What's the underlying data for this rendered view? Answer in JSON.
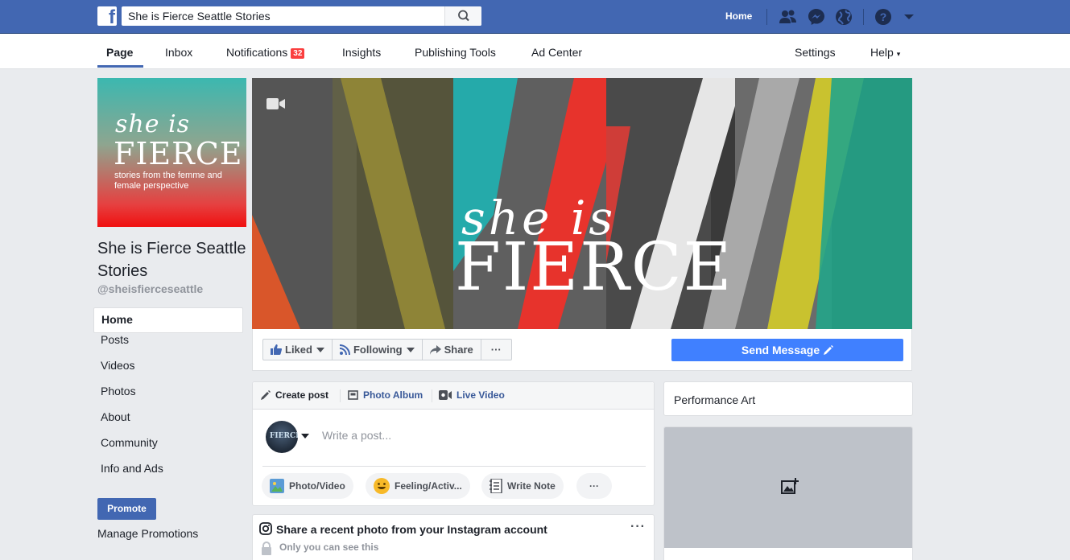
{
  "topbar": {
    "logo_letter": "f",
    "search_value": "She is Fierce Seattle Stories",
    "search_placeholder": "Search",
    "home_label": "Home",
    "icons": [
      "friends-icon",
      "messenger-icon",
      "globe-icon",
      "help-icon",
      "caret-down-icon"
    ]
  },
  "pagenav": {
    "tabs": [
      {
        "label": "Page"
      },
      {
        "label": "Inbox"
      },
      {
        "label": "Notifications",
        "badge": "32"
      },
      {
        "label": "Insights"
      },
      {
        "label": "Publishing Tools"
      },
      {
        "label": "Ad Center"
      }
    ],
    "settings_label": "Settings",
    "help_label": "Help",
    "help_caret": "▾"
  },
  "profile": {
    "pic_title_top": "she is",
    "pic_title_bottom": "FIERCE",
    "pic_tagline": "stories from the femme and female perspective",
    "name": "She is Fierce Seattle Stories",
    "handle": "@sheisfierceseattle"
  },
  "leftnav": {
    "items": [
      "Home",
      "Posts",
      "Videos",
      "Photos",
      "About",
      "Community",
      "Info and Ads"
    ],
    "promote_label": "Promote",
    "manage_promotions_label": "Manage Promotions"
  },
  "cover": {
    "title_top": "she is",
    "title_bottom": "FIERCE"
  },
  "actions": {
    "liked_label": "Liked",
    "following_label": "Following",
    "share_label": "Share",
    "more_label": "···",
    "send_message_label": "Send Message"
  },
  "composer": {
    "tabs": [
      "Create post",
      "Photo Album",
      "Live Video"
    ],
    "avatar_text": "FIERCE",
    "placeholder": "Write a post...",
    "pills": [
      "Photo/Video",
      "Feeling/Activ...",
      "Write Note",
      "···"
    ]
  },
  "instagram": {
    "title": "Share a recent photo from your Instagram account",
    "subtitle": "Only you can see this",
    "dots": "···"
  },
  "right": {
    "category": "Performance Art"
  },
  "colors": {
    "brand_blue": "#4267b2",
    "send_blue": "#4080ff",
    "badge_red": "#fa3e3e",
    "page_bg": "#e9ebee"
  }
}
